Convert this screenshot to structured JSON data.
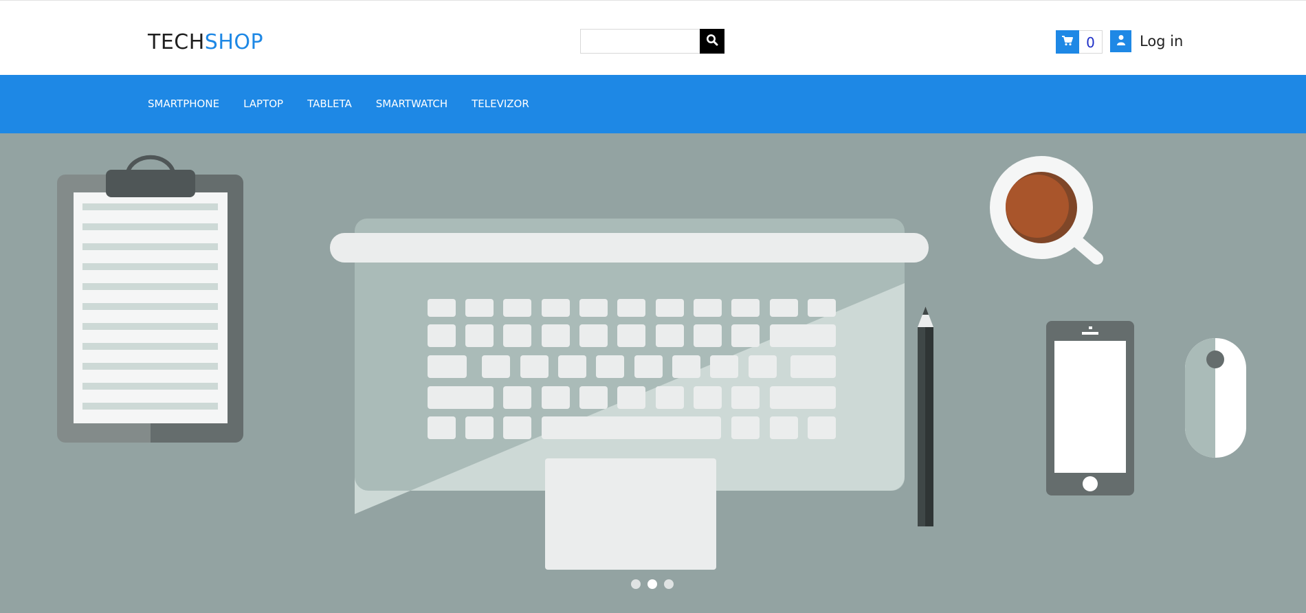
{
  "brand": {
    "part1": "TECH",
    "part2": "SHOP"
  },
  "search": {
    "placeholder": "",
    "value": "",
    "icon": "search-icon"
  },
  "cart": {
    "count": "0",
    "icon": "cart-icon"
  },
  "user": {
    "label": "Log in",
    "icon": "user-icon"
  },
  "nav": {
    "items": [
      "SMARTPHONE",
      "LAPTOP",
      "TABLETA",
      "SMARTWATCH",
      "TELEVIZOR"
    ]
  },
  "carousel": {
    "slides": 3,
    "active_index": 1
  },
  "colors": {
    "accent": "#1e88e5",
    "hero_bg": "#93a3a2",
    "search_button": "#000000"
  }
}
